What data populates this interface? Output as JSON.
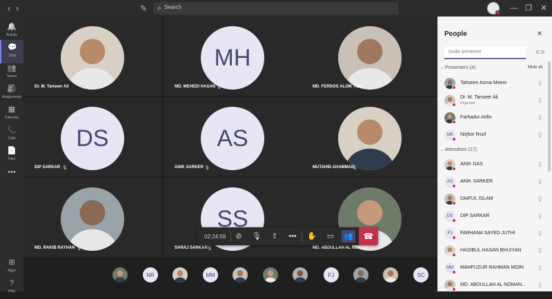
{
  "titlebar": {
    "back": "‹",
    "forward": "›",
    "more": "•••",
    "search_placeholder": "Search"
  },
  "rail": [
    {
      "label": "Activity",
      "icon": "bell-icon",
      "glyph": "🔔"
    },
    {
      "label": "Chat",
      "icon": "chat-icon",
      "glyph": "💬"
    },
    {
      "label": "Teams",
      "icon": "teams-icon",
      "glyph": "👥"
    },
    {
      "label": "Assignments",
      "icon": "assignments-icon",
      "glyph": "🎒"
    },
    {
      "label": "Calendar",
      "icon": "calendar-icon",
      "glyph": "▦"
    },
    {
      "label": "Calls",
      "icon": "phone-icon",
      "glyph": "📞"
    },
    {
      "label": "Files",
      "icon": "files-icon",
      "glyph": "📄"
    },
    {
      "label": "•••",
      "icon": "more-icon",
      "glyph": ""
    },
    {
      "label": "Apps",
      "icon": "apps-icon",
      "glyph": "⊞"
    },
    {
      "label": "Help",
      "icon": "help-icon",
      "glyph": "?"
    }
  ],
  "tiles": [
    {
      "name": "Dr. M. Tanseer Ali",
      "initials": "",
      "photo": true
    },
    {
      "name": "MD. MEHEDI HASAN",
      "initials": "MH",
      "photo": false
    },
    {
      "name": "MD. FERDOS ALOM TIER",
      "initials": "",
      "photo": true
    },
    {
      "name": "DIP SARKAR",
      "initials": "DS",
      "photo": false
    },
    {
      "name": "ANIK SARKER",
      "initials": "AS",
      "photo": false
    },
    {
      "name": "MUTAHID AHAMMAD",
      "initials": "",
      "photo": true
    },
    {
      "name": "MD. RAKIB RAYHAN",
      "initials": "",
      "photo": true
    },
    {
      "name": "SARAJ SARKAR",
      "initials": "SS",
      "photo": false
    },
    {
      "name": "MD. ABDULLAH AL NOMAN",
      "initials": "",
      "photo": true
    }
  ],
  "controls": {
    "timer": "02:24:59"
  },
  "strip": [
    {
      "initials": "",
      "photo": true
    },
    {
      "initials": "NR",
      "photo": false
    },
    {
      "initials": "",
      "photo": true
    },
    {
      "initials": "MM",
      "photo": false
    },
    {
      "initials": "",
      "photo": true
    },
    {
      "initials": "",
      "photo": true
    },
    {
      "initials": "",
      "photo": true
    },
    {
      "initials": "FJ",
      "photo": false
    },
    {
      "initials": "",
      "photo": true
    },
    {
      "initials": "",
      "photo": true
    },
    {
      "initials": "SC",
      "photo": false
    }
  ],
  "panel": {
    "title": "People",
    "invite_placeholder": "Invite someone",
    "presenters_label": "Presenters (4)",
    "mute_all": "Mute all",
    "attendees_label": "Attendees (17)",
    "presenters": [
      {
        "name": "Tahseen Asma Meem",
        "initials": "",
        "role": ""
      },
      {
        "name": "Dr. M. Tanseer Ali",
        "initials": "",
        "role": "Organizer"
      },
      {
        "name": "Farhadur Arifin",
        "initials": "",
        "role": ""
      },
      {
        "name": "Nirjhor Rouf",
        "initials": "NR",
        "role": ""
      }
    ],
    "attendees": [
      {
        "name": "ANIK DAS",
        "initials": ""
      },
      {
        "name": "ANIK SARKER",
        "initials": "AS"
      },
      {
        "name": "DAIFUL ISLAM",
        "initials": ""
      },
      {
        "name": "DIP SARKAR",
        "initials": "DS"
      },
      {
        "name": "FARHANA SAYED JUTHI",
        "initials": "FJ"
      },
      {
        "name": "HASIBUL HASAN BHUIYAN",
        "initials": ""
      },
      {
        "name": "MAHFUZUR RAHMAN MOIN",
        "initials": "MM"
      },
      {
        "name": "MD. ABDULLAH AL NOMAN...",
        "initials": ""
      }
    ]
  },
  "colors": {
    "accent": "#6264a7",
    "hangup": "#c4314b",
    "initials_bg": "#e8e6f4",
    "initials_fg": "#464775"
  }
}
